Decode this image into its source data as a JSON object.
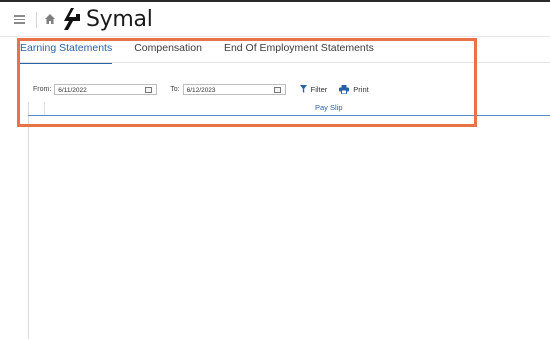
{
  "header": {
    "logo_text": "Symal"
  },
  "tabs": [
    {
      "label": "Earning Statements",
      "active": true
    },
    {
      "label": "Compensation",
      "active": false
    },
    {
      "label": "End Of Employment Statements",
      "active": false
    }
  ],
  "filters": {
    "from_label": "From:",
    "from_value": "6/11/2022",
    "to_label": "To:",
    "to_value": "6/12/2023",
    "filter_label": "Filter",
    "print_label": "Print"
  },
  "grid": {
    "column_header": "Pay Slip"
  },
  "colors": {
    "accent": "#2a62a8",
    "highlight": "#e8734b"
  }
}
